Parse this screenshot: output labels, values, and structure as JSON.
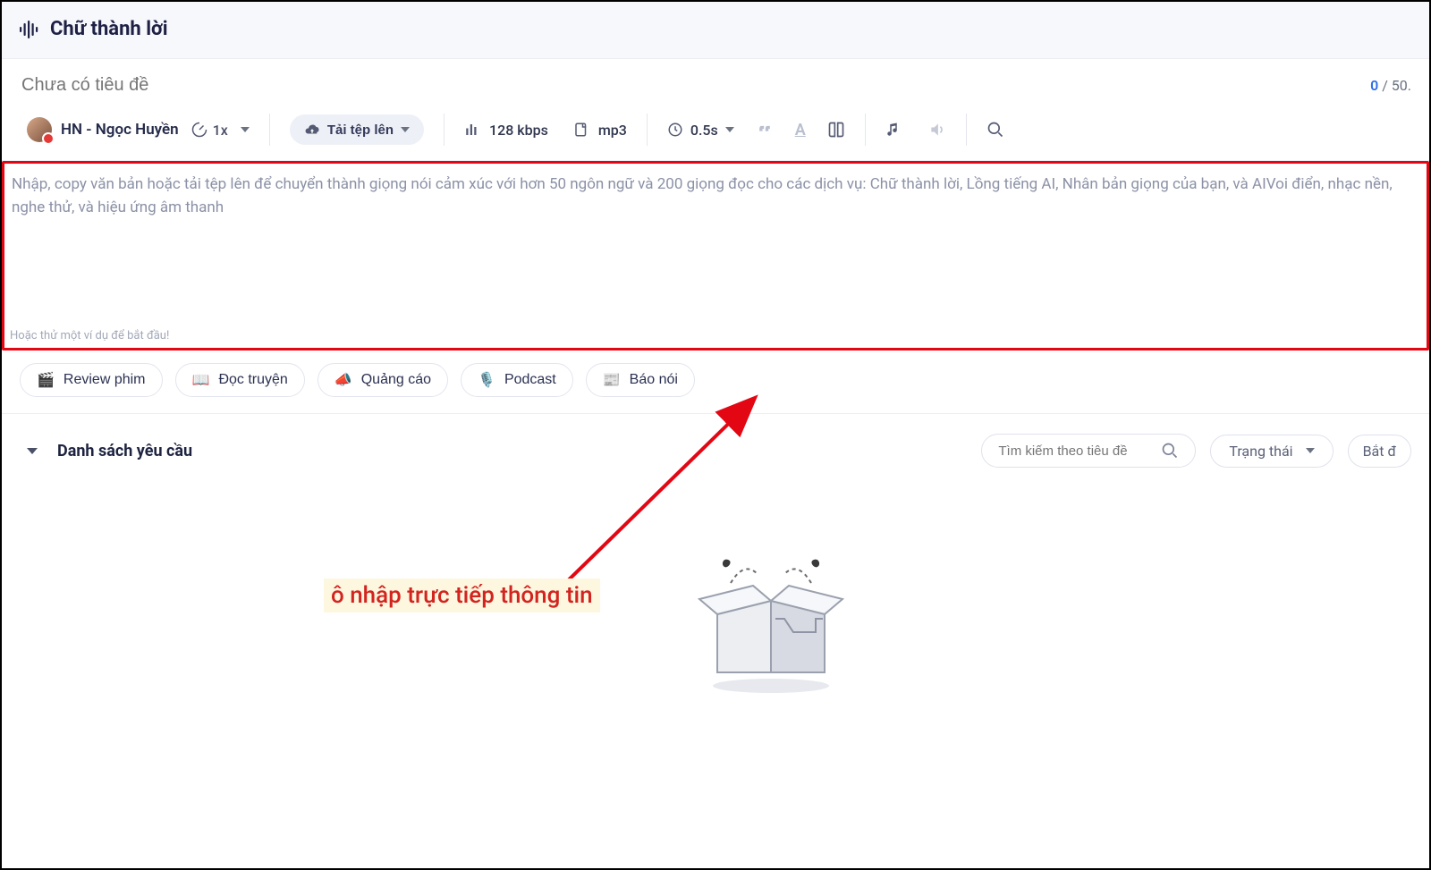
{
  "header": {
    "title": "Chữ thành lời"
  },
  "titleRow": {
    "placeholder": "Chưa có tiêu đề"
  },
  "counter": {
    "current": "0",
    "sep": " / ",
    "limit": "50."
  },
  "toolbar": {
    "voiceName": "HN - Ngọc Huyền",
    "speed": "1x",
    "upload": "Tải tệp lên",
    "bitrate": "128 kbps",
    "format": "mp3",
    "pause": "0.5s"
  },
  "textArea": {
    "placeholder": "Nhập, copy văn bản hoặc tải tệp lên để chuyển thành giọng nói cảm xúc với hơn 50 ngôn ngữ và 200 giọng đọc cho các dịch vụ: Chữ thành lời, Lồng tiếng AI, Nhân bản giọng của bạn, và AIVoi điển, nhạc nền, nghe thử, và hiệu ứng âm thanh",
    "exampleHint": "Hoặc thử một ví dụ để bắt đầu!"
  },
  "examples": {
    "review": "Review phim",
    "story": "Đọc truyện",
    "ads": "Quảng cáo",
    "podcast": "Podcast",
    "news": "Báo nói"
  },
  "requests": {
    "title": "Danh sách yêu cầu",
    "searchPlaceholder": "Tìm kiếm theo tiêu đề",
    "status": "Trạng thái",
    "start": "Bắt đ"
  },
  "annotation": {
    "label": "ô nhập trực tiếp thông tin"
  }
}
